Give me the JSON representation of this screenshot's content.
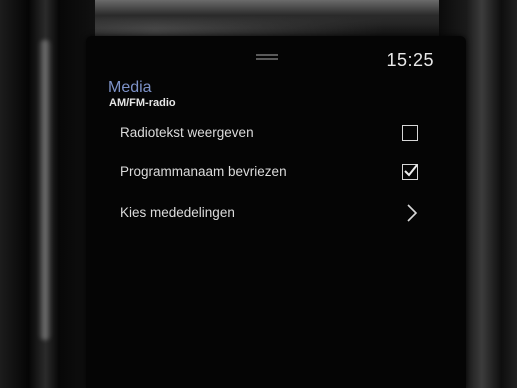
{
  "status": {
    "time": "15:25"
  },
  "header": {
    "title": "Media",
    "subtitle": "AM/FM-radio"
  },
  "settings": [
    {
      "label": "Radiotekst weergeven",
      "control": "checkbox",
      "checked": false
    },
    {
      "label": "Programmanaam bevriezen",
      "control": "checkbox",
      "checked": true
    },
    {
      "label": "Kies mededelingen",
      "control": "submenu"
    }
  ],
  "colors": {
    "title": "#7d92c8",
    "text": "#dcdcdc",
    "background": "#050505"
  }
}
